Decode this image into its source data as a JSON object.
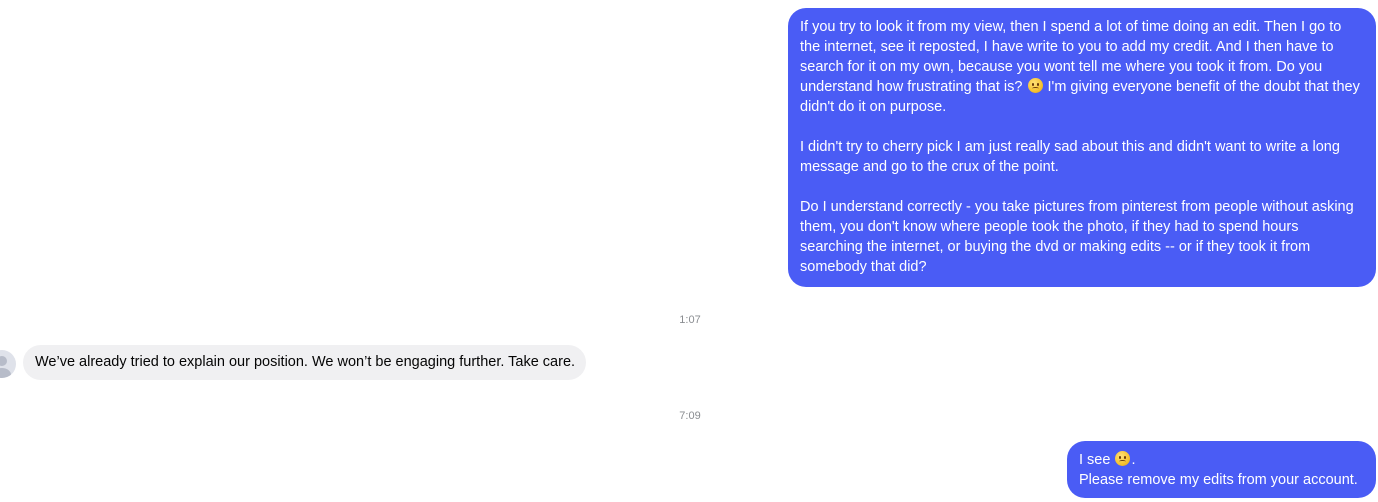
{
  "messages": {
    "msg1": {
      "para1_part1": "If you try to look it from my view, then I spend a lot of time doing an edit. Then I go to the internet, see it reposted, I have write to you to add my credit. And I then have to search for it on my own, because you wont tell me where you took it from. Do you understand how frustrating that is?",
      "para1_part2": "I'm giving everyone benefit of the doubt that they didn't do it on purpose.",
      "para2": "I didn't try to cherry pick I am just really sad about this and didn't want to write a long message and go to the crux of the point.",
      "para3": "Do I understand correctly - you take pictures from pinterest from people without asking them, you don't know where people took the photo, if they had to spend hours searching the internet, or buying the dvd or making edits -- or if they took it from somebody that did?"
    },
    "time1": "1:07",
    "msg2": "We’ve already tried to explain our position. We won’t be engaging further. Take care.",
    "time2": "7:09",
    "msg3": {
      "line1": "I see",
      "line1_end": ".",
      "line2": "Please remove my edits from your account."
    }
  },
  "colors": {
    "outgoing_bubble": "#4a5cf5",
    "incoming_bubble": "#f0f0f2",
    "timestamp": "#8a8d91"
  },
  "icons": {
    "emoji": "frowning-face-icon",
    "avatar": "default-avatar-icon"
  }
}
